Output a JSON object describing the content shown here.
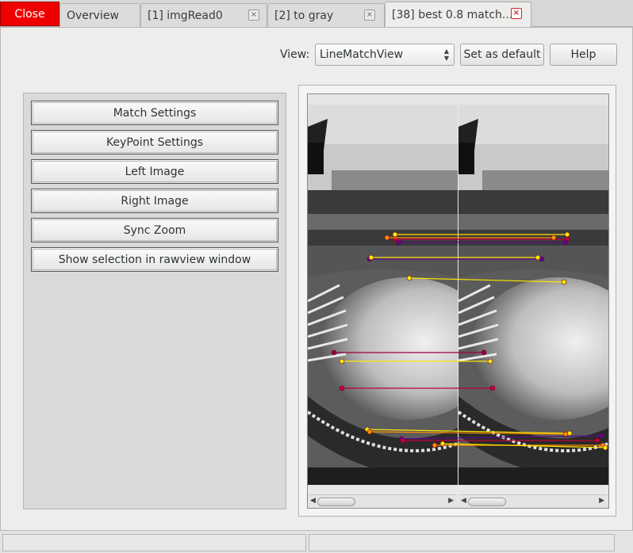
{
  "tabs": {
    "close_label": "Close",
    "items": [
      {
        "label": "Overview",
        "closable": false
      },
      {
        "label": "[1] imgRead0",
        "closable": true
      },
      {
        "label": "[2] to gray",
        "closable": true
      },
      {
        "label": "[38] best 0.8 match...",
        "closable": true,
        "active": true
      }
    ],
    "close_glyph": "×"
  },
  "toolbar": {
    "view_label": "View:",
    "view_value": "LineMatchView",
    "set_default_label": "Set as default",
    "help_label": "Help"
  },
  "side_buttons": [
    "Match Settings",
    "KeyPoint Settings",
    "Left Image",
    "Right Image",
    "Sync Zoom",
    "Show selection in rawview window"
  ],
  "match_colors": {
    "yellow": "#ffe600",
    "purple": "#5a0a8c",
    "crimson": "#c0003a",
    "orange": "#ff8c00",
    "maroon": "#9a0040"
  }
}
